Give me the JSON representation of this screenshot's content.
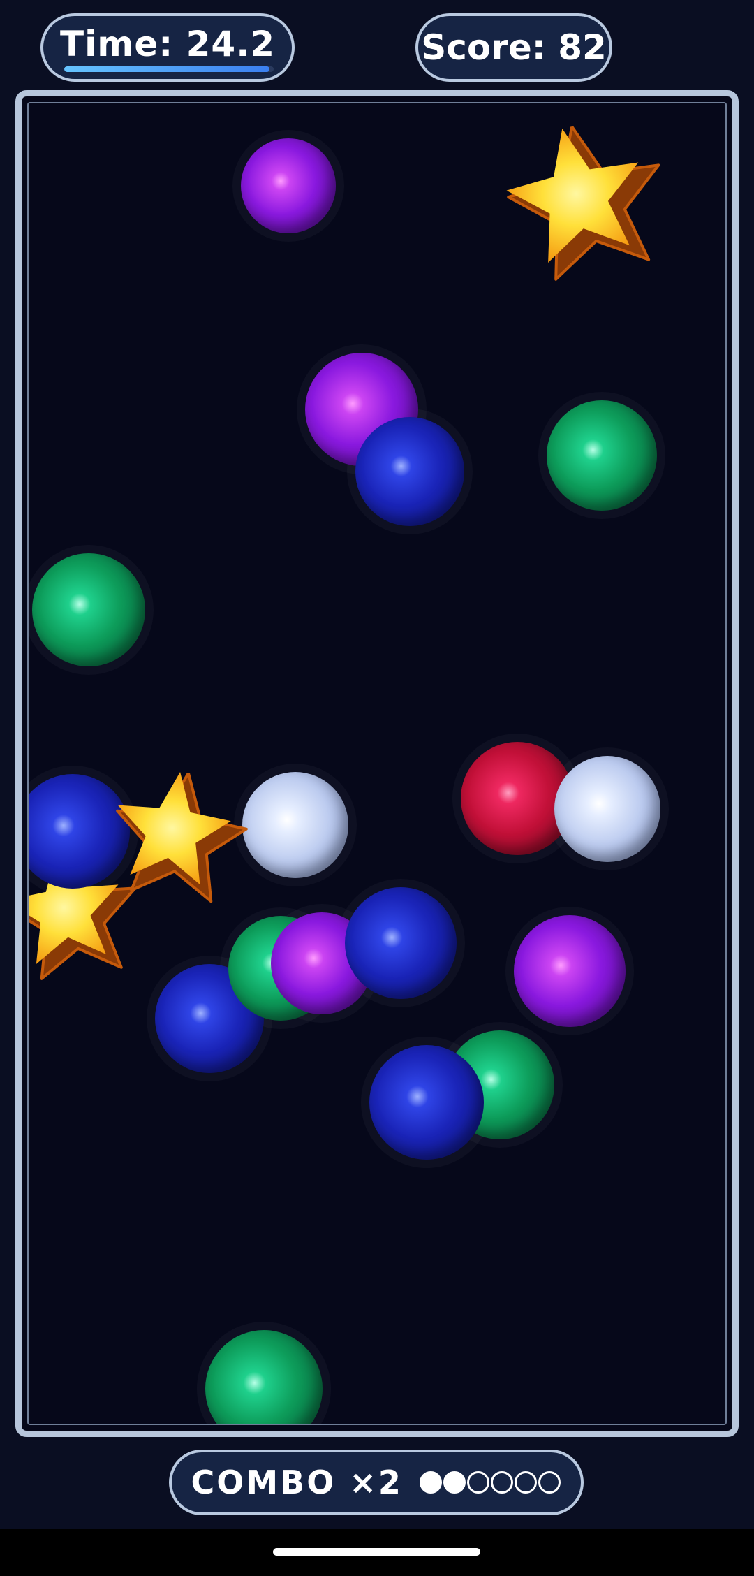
{
  "hud": {
    "timer_label": "Time: 24.2",
    "timer_progress": 0.98,
    "score_label": "Score: 82"
  },
  "combo": {
    "label": "COMBO ×2",
    "filled": 2,
    "total": 6
  },
  "colors": {
    "purple": "#8a19df",
    "blue": "#1a24b8",
    "green": "#0d9c5a",
    "red": "#c21038",
    "white": "#d8e2fa",
    "star": "#ffe03a"
  },
  "orbs": [
    {
      "color": "purple"
    },
    {
      "color": "purple"
    },
    {
      "color": "blue"
    },
    {
      "color": "green"
    },
    {
      "color": "green"
    },
    {
      "color": "blue"
    },
    {
      "color": "white"
    },
    {
      "color": "red"
    },
    {
      "color": "white"
    },
    {
      "color": "blue"
    },
    {
      "color": "green"
    },
    {
      "color": "purple"
    },
    {
      "color": "blue"
    },
    {
      "color": "purple"
    },
    {
      "color": "green"
    },
    {
      "color": "blue"
    },
    {
      "color": "green"
    }
  ],
  "stars": [
    {
      "icon": "star-icon"
    },
    {
      "icon": "star-icon"
    },
    {
      "icon": "star-icon"
    }
  ]
}
